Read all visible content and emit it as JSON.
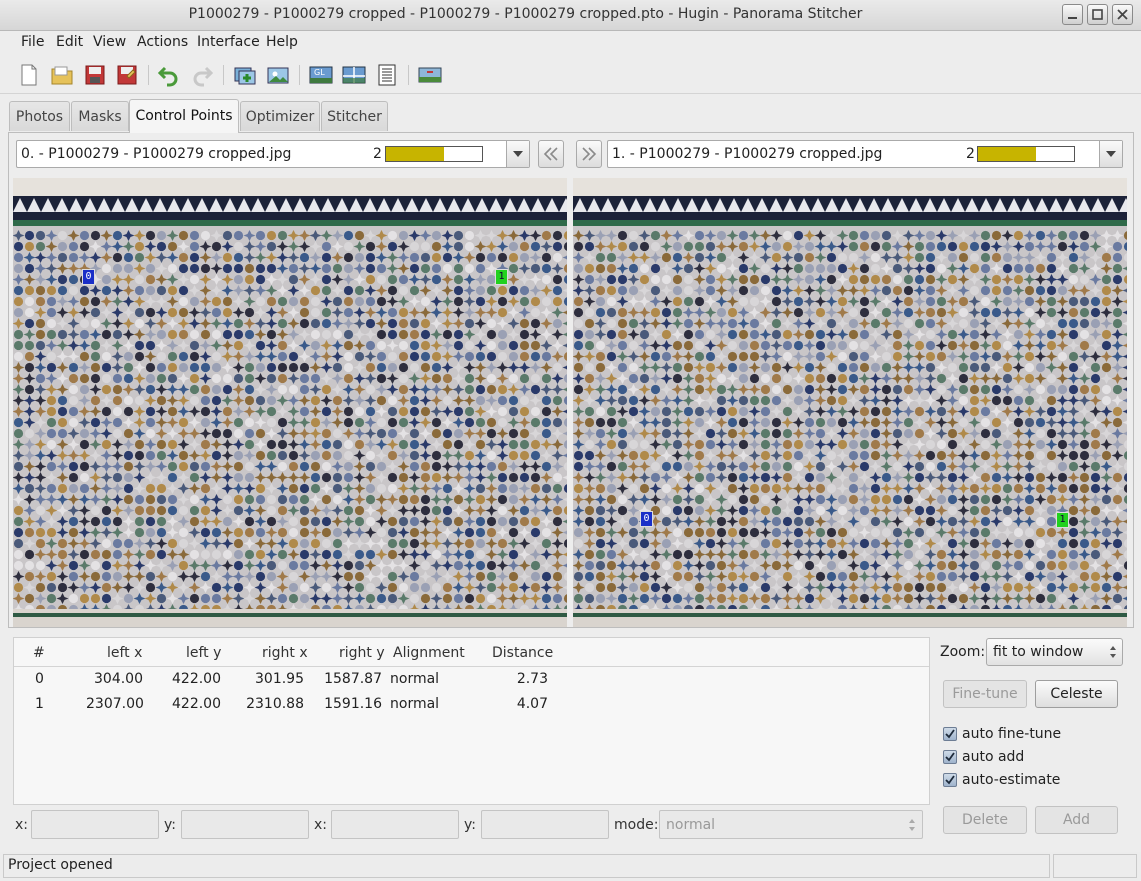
{
  "window": {
    "title": "P1000279 - P1000279 cropped - P1000279 - P1000279 cropped.pto - Hugin - Panorama Stitcher"
  },
  "menu": [
    "File",
    "Edit",
    "View",
    "Actions",
    "Interface",
    "Help"
  ],
  "toolbar": {
    "icons": [
      "new-file-icon",
      "open-folder-icon",
      "save-icon",
      "save-as-icon",
      "undo-icon",
      "redo-icon",
      "add-images-icon",
      "add-image-series-icon",
      "gl-preview-icon",
      "preview-panorama-icon",
      "image-list-icon",
      "layout-icon"
    ]
  },
  "tabs": [
    "Photos",
    "Masks",
    "Control Points",
    "Optimizer",
    "Stitcher"
  ],
  "active_tab": "Control Points",
  "left_image": {
    "label": "0. - P1000279 - P1000279 cropped.jpg",
    "count": "2",
    "fill_fraction": 0.6
  },
  "right_image": {
    "label": "1. - P1000279 - P1000279 cropped.jpg",
    "count": "2",
    "fill_fraction": 0.6
  },
  "table": {
    "headers": [
      "#",
      "left x",
      "left y",
      "right x",
      "right y",
      "Alignment",
      "Distance"
    ],
    "rows": [
      [
        "0",
        "304.00",
        "422.00",
        "301.95",
        "1587.87",
        "normal",
        "2.73"
      ],
      [
        "1",
        "2307.00",
        "422.00",
        "2310.88",
        "1591.16",
        "normal",
        "4.07"
      ]
    ]
  },
  "zoom": {
    "label": "Zoom:",
    "value": "fit to window"
  },
  "buttons": {
    "fine_tune": "Fine-tune",
    "celeste": "Celeste",
    "delete": "Delete",
    "add": "Add"
  },
  "checkboxes": [
    {
      "label": "auto fine-tune",
      "checked": true
    },
    {
      "label": "auto add",
      "checked": true
    },
    {
      "label": "auto-estimate",
      "checked": true
    }
  ],
  "coords": {
    "x1": "x:",
    "y1": "y:",
    "x2": "x:",
    "y2": "y:",
    "mode_label": "mode:",
    "mode_value": "normal"
  },
  "control_point_markers": {
    "left": [
      "0",
      "1"
    ],
    "right": [
      "0",
      "1"
    ]
  },
  "status": "Project opened",
  "colors": {
    "point0": "#1a2fc8",
    "point1": "#22d11f",
    "bar_fill": "#c7b400"
  }
}
